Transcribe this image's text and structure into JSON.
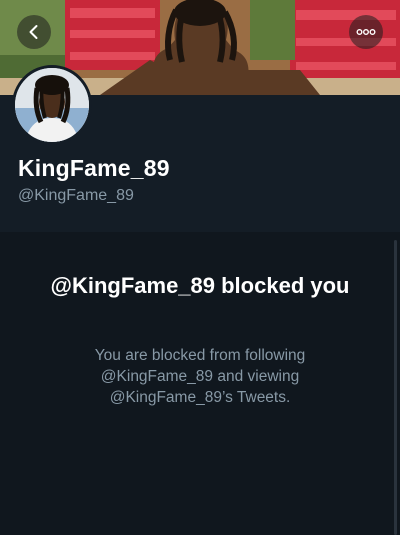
{
  "profile": {
    "display_name": "KingFame_89",
    "handle": "@KingFame_89"
  },
  "blocked": {
    "title": "@KingFame_89 blocked you",
    "description": "You are blocked from following @KingFame_89 and viewing @KingFame_89’s Tweets."
  },
  "icons": {
    "back": "chevron-left-icon",
    "more": "more-dots-icon"
  },
  "colors": {
    "background": "#141d26",
    "panel": "#10171e",
    "text_primary": "#ffffff",
    "text_secondary": "#8899a6"
  }
}
